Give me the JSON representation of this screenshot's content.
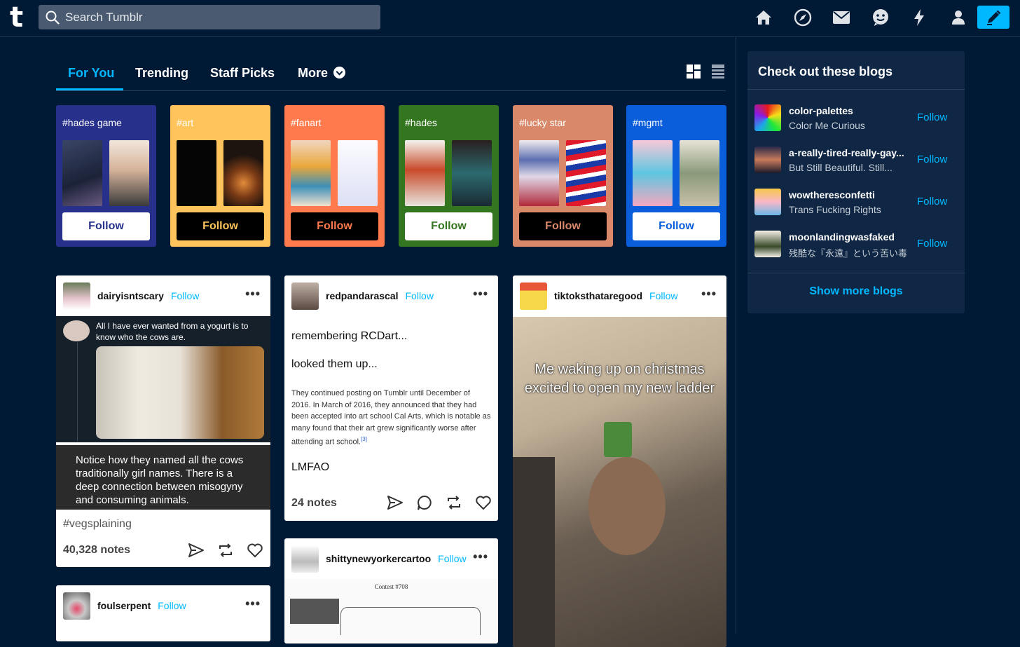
{
  "header": {
    "logo": "t",
    "search_placeholder": "Search Tumblr",
    "icons": [
      "home-icon",
      "explore-icon",
      "inbox-icon",
      "messages-icon",
      "activity-icon",
      "account-icon"
    ],
    "compose_icon": "pencil-icon",
    "accent": "#00b8ff"
  },
  "tabs": [
    {
      "label": "For You",
      "active": true
    },
    {
      "label": "Trending",
      "active": false
    },
    {
      "label": "Staff Picks",
      "active": false
    },
    {
      "label": "More",
      "active": false
    }
  ],
  "tag_cards": [
    {
      "tag": "#hades game",
      "follow": "Follow",
      "bg": "#27308a",
      "btn_bg": "#ffffff",
      "btn_fg": "#27308a"
    },
    {
      "tag": "#art",
      "follow": "Follow",
      "bg": "#ffc45c",
      "btn_bg": "#000000",
      "btn_fg": "#ffc45c"
    },
    {
      "tag": "#fanart",
      "follow": "Follow",
      "bg": "#ff7a4d",
      "btn_bg": "#000000",
      "btn_fg": "#ff7a4d"
    },
    {
      "tag": "#hades",
      "follow": "Follow",
      "bg": "#347520",
      "btn_bg": "#ffffff",
      "btn_fg": "#347520"
    },
    {
      "tag": "#lucky star",
      "follow": "Follow",
      "bg": "#d9896a",
      "btn_bg": "#000000",
      "btn_fg": "#d9896a"
    },
    {
      "tag": "#mgmt",
      "follow": "Follow",
      "bg": "#0a5ddb",
      "btn_bg": "#ffffff",
      "btn_fg": "#0a5ddb"
    }
  ],
  "posts": {
    "dairy": {
      "blog": "dairyisntscary",
      "follow": "Follow",
      "quote": "All I have ever wanted from a yogurt is to know who the cows are.",
      "caption": "Notice how they named all the cows traditionally girl names. There is a deep connection between misogyny and consuming animals.",
      "tag": "#vegsplaining",
      "notes": "40,328 notes"
    },
    "redpanda": {
      "blog": "redpandarascal",
      "follow": "Follow",
      "line1": "remembering RCDart...",
      "line2": "looked them up...",
      "excerpt": "They continued posting on Tumblr until December of 2016. In March of 2016, they announced that they had been accepted into art school Cal Arts, which is notable as many found that their art grew significantly worse after attending art school.",
      "ref": "[3]",
      "line3": "LMFAO",
      "notes": "24 notes"
    },
    "tiktok": {
      "blog": "tiktoksthataregood",
      "follow": "Follow",
      "overlay": "Me waking up on christmas excited to open my new ladder"
    },
    "newyorker": {
      "blog": "shittynewyorkercartoo",
      "follow": "Follow",
      "contest": "Contest #708"
    },
    "foul": {
      "blog": "foulserpent",
      "follow": "Follow"
    }
  },
  "sidebar": {
    "title": "Check out these blogs",
    "blogs": [
      {
        "name": "color-palettes",
        "desc": "Color Me Curious",
        "follow": "Follow"
      },
      {
        "name": "a-really-tired-really-gay...",
        "desc": "But Still Beautiful. Still...",
        "follow": "Follow"
      },
      {
        "name": "wowtheresconfetti",
        "desc": "Trans Fucking Rights",
        "follow": "Follow"
      },
      {
        "name": "moonlandingwasfaked",
        "desc": "残酷な『永遠』という苦い毒",
        "follow": "Follow"
      }
    ],
    "show_more": "Show more blogs"
  }
}
